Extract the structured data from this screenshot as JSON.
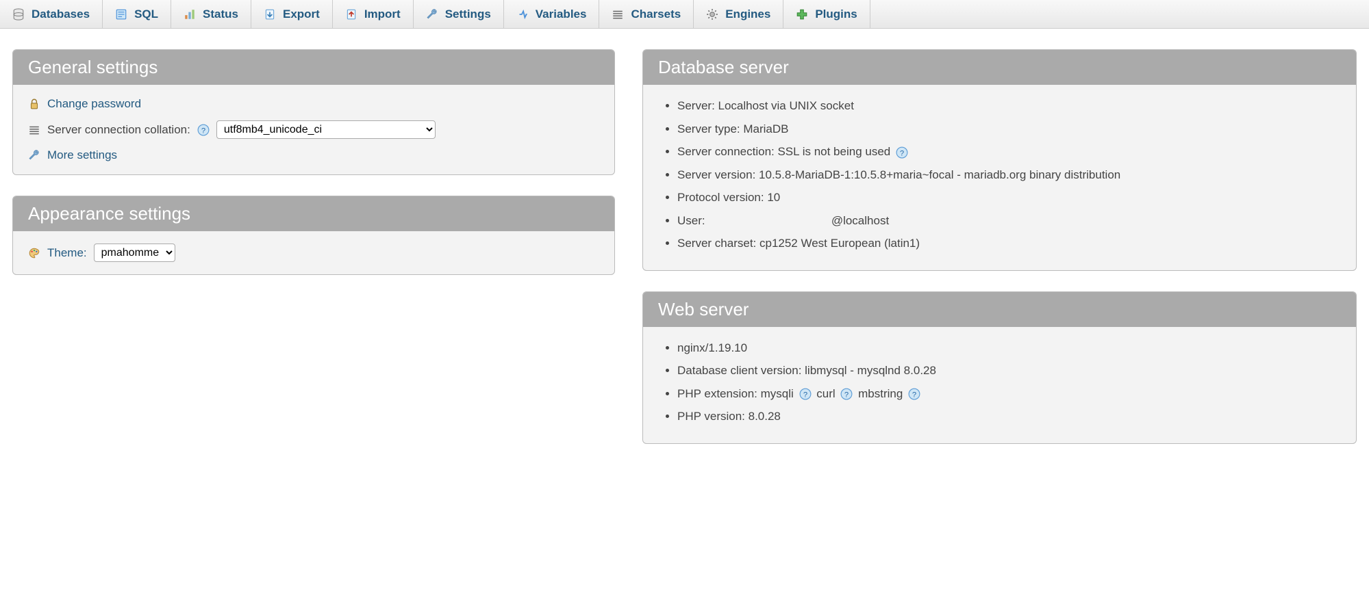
{
  "nav": {
    "items": [
      {
        "label": "Databases",
        "icon": "database"
      },
      {
        "label": "SQL",
        "icon": "sql"
      },
      {
        "label": "Status",
        "icon": "status"
      },
      {
        "label": "Export",
        "icon": "export"
      },
      {
        "label": "Import",
        "icon": "import"
      },
      {
        "label": "Settings",
        "icon": "settings"
      },
      {
        "label": "Variables",
        "icon": "variables"
      },
      {
        "label": "Charsets",
        "icon": "charsets"
      },
      {
        "label": "Engines",
        "icon": "engines"
      },
      {
        "label": "Plugins",
        "icon": "plugins"
      }
    ]
  },
  "general": {
    "title": "General settings",
    "change_password": "Change password",
    "collation_label": "Server connection collation:",
    "collation_value": "utf8mb4_unicode_ci",
    "more_settings": "More settings"
  },
  "appearance": {
    "title": "Appearance settings",
    "theme_label": "Theme:",
    "theme_value": "pmahomme"
  },
  "dbserver": {
    "title": "Database server",
    "items": [
      "Server: Localhost via UNIX socket",
      "Server type: MariaDB",
      "Server connection: SSL is not being used",
      "Server version: 10.5.8-MariaDB-1:10.5.8+maria~focal - mariadb.org binary distribution",
      "Protocol version: 10",
      "User:                                       @localhost",
      "Server charset: cp1252 West European (latin1)"
    ]
  },
  "webserver": {
    "title": "Web server",
    "nginx": "nginx/1.19.10",
    "db_client": "Database client version: libmysql - mysqlnd 8.0.28",
    "php_ext_label": "PHP extension:",
    "php_ext_1": "mysqli",
    "php_ext_2": "curl",
    "php_ext_3": "mbstring",
    "php_version": "PHP version: 8.0.28"
  }
}
